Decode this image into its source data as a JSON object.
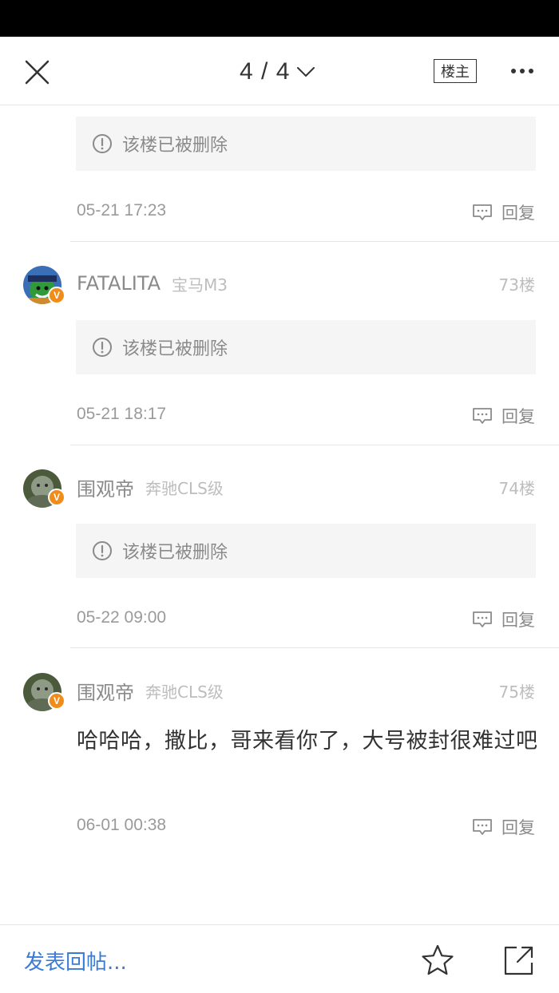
{
  "header": {
    "page_indicator": "4 / 4",
    "louzhu_label": "楼主"
  },
  "posts": [
    {
      "deleted_text": "该楼已被删除",
      "time": "05-21 17:23",
      "reply_label": "回复"
    },
    {
      "username": "FATALITA",
      "car_model": "宝马M3",
      "floor": "73楼",
      "deleted_text": "该楼已被删除",
      "time": "05-21 18:17",
      "reply_label": "回复",
      "badge": "V"
    },
    {
      "username": "围观帝",
      "car_model": "奔驰CLS级",
      "floor": "74楼",
      "deleted_text": "该楼已被删除",
      "time": "05-22 09:00",
      "reply_label": "回复",
      "badge": "V"
    },
    {
      "username": "围观帝",
      "car_model": "奔驰CLS级",
      "floor": "75楼",
      "content": "哈哈哈，撒比，哥来看你了，大号被封很难过吧",
      "time": "06-01 00:38",
      "reply_label": "回复",
      "badge": "V"
    }
  ],
  "bottom_bar": {
    "compose_label": "发表回帖..."
  },
  "colors": {
    "accent_blue": "#3a7bd5",
    "badge_orange": "#f08c1a",
    "deleted_bg": "#f5f5f5"
  },
  "icons": {
    "close": "close-icon",
    "chevron": "chevron-down-icon",
    "more": "more-dots-icon",
    "warning": "exclamation-circle-icon",
    "reply": "comment-bubble-icon",
    "star": "star-icon",
    "share": "share-icon"
  }
}
